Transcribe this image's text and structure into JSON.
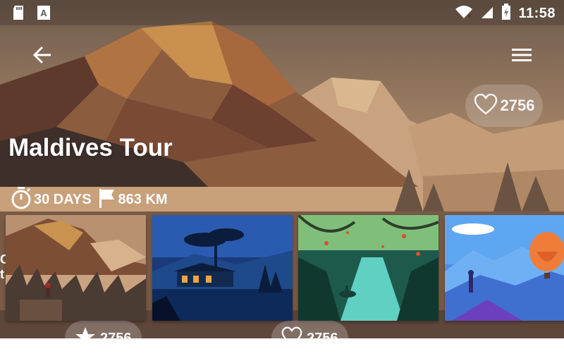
{
  "status_bar": {
    "time": "11:58",
    "icons": [
      "sd-card-icon",
      "keyboard-a-icon",
      "wifi-icon",
      "signal-icon",
      "battery-charging-icon"
    ]
  },
  "app_bar": {
    "back_icon": "arrow-back-icon",
    "menu_icon": "hamburger-menu-icon"
  },
  "tour": {
    "title": "Maldives Tour",
    "likes": "2756",
    "duration": "30 DAYS",
    "distance": "863 KM"
  },
  "thumbnails": [
    {
      "name": "mountain-lake-hiker"
    },
    {
      "name": "night-cabin-lake"
    },
    {
      "name": "forest-river-boat"
    },
    {
      "name": "blue-mountains-balloon"
    }
  ],
  "bottom_pills": [
    {
      "icon": "star-icon",
      "count": "2756"
    },
    {
      "icon": "heart-outline-icon",
      "count": "2756"
    }
  ],
  "colors": {
    "sky_top": "#7a6553",
    "sand": "#c9a27a",
    "peak": "#d9b27a",
    "accent_orange": "#e08a3a"
  }
}
